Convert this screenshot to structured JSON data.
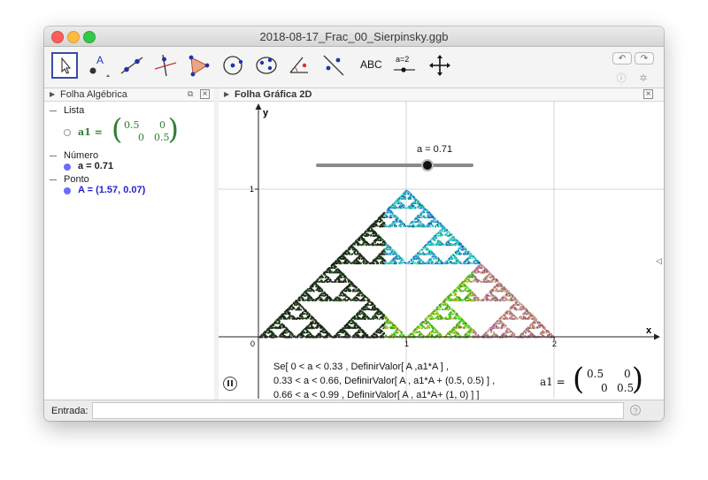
{
  "window": {
    "title": "2018-08-17_Frac_00_Sierpinsky.ggb"
  },
  "toolbar": {
    "tools": [
      {
        "name": "move-tool",
        "active": true
      },
      {
        "name": "point-tool",
        "label": "A"
      },
      {
        "name": "line-tool"
      },
      {
        "name": "perpendicular-tool"
      },
      {
        "name": "polygon-tool"
      },
      {
        "name": "circle-tool"
      },
      {
        "name": "conic-tool"
      },
      {
        "name": "angle-tool"
      },
      {
        "name": "reflect-tool"
      },
      {
        "name": "text-tool",
        "label": "ABC"
      },
      {
        "name": "slider-tool",
        "label": "a=2"
      },
      {
        "name": "move-graphics-tool"
      }
    ]
  },
  "algebra": {
    "title": "Folha Algébrica",
    "categories": [
      {
        "name": "Lista",
        "items": [
          {
            "label": "a1 =",
            "matrix": [
              [
                "0.5",
                "0"
              ],
              [
                "0",
                "0.5"
              ]
            ],
            "color": "#2e7d32"
          }
        ]
      },
      {
        "name": "Número",
        "items": [
          {
            "text": "a = 0.71",
            "color": "#222222"
          }
        ]
      },
      {
        "name": "Ponto",
        "items": [
          {
            "text": "A = (1.57, 0.07)",
            "color": "#2323cc"
          }
        ]
      }
    ]
  },
  "graphics": {
    "title": "Folha Gráfica 2D",
    "slider": {
      "label": "a = 0.71",
      "value": 0.71,
      "min": 0,
      "max": 1
    },
    "axes": {
      "x_label": "x",
      "y_label": "y",
      "x_ticks": [
        "0",
        "1",
        "2"
      ],
      "y_ticks": [
        "1"
      ]
    },
    "formula_lines": [
      "Se[ 0 < a < 0.33 , DefinirValor[ A ,a1*A ] ,",
      "0.33 < a < 0.66,  DefinirValor[ A , a1*A + (0.5, 0.5) ] ,",
      "0.66 < a < 0.99 , DefinirValor[ A , a1*A+ (1, 0) ] ]"
    ],
    "matrix_label": "a1 =",
    "matrix": [
      [
        "0.5",
        "0"
      ],
      [
        "0",
        "0.5"
      ]
    ]
  },
  "input": {
    "label": "Entrada:",
    "value": "",
    "help_icon": "help-icon"
  },
  "colors": {
    "accent": "#3b4aa8",
    "point_blue": "#6b6bff",
    "list_green": "#2e7d32"
  }
}
